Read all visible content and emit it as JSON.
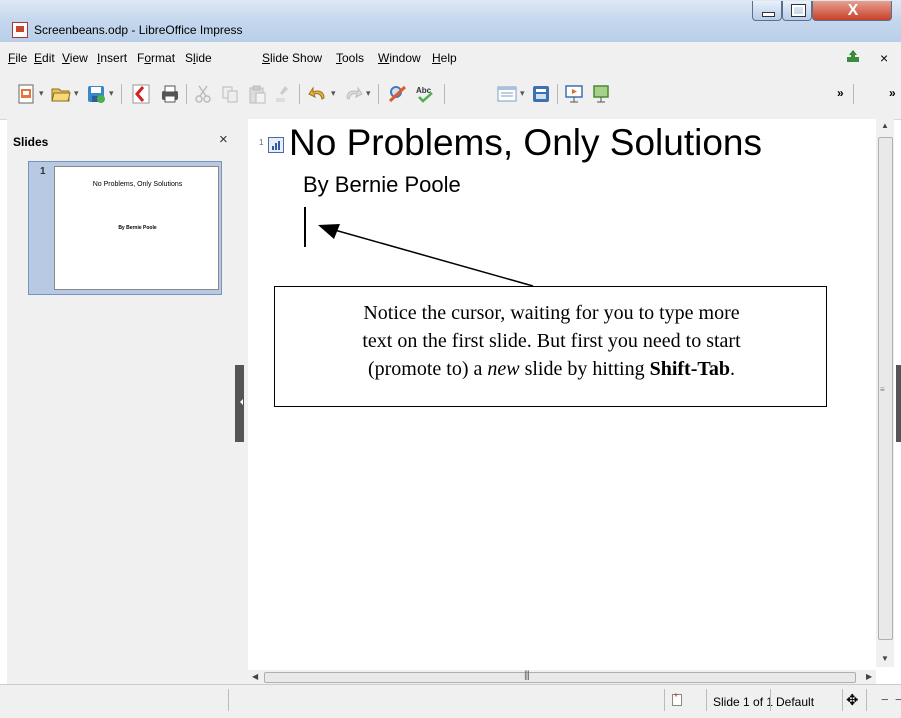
{
  "window": {
    "title": "Screenbeans.odp - LibreOffice Impress",
    "close_glyph": "X"
  },
  "menu": {
    "items": [
      {
        "key": "F",
        "rest": "ile"
      },
      {
        "key": "E",
        "rest": "dit"
      },
      {
        "key": "V",
        "rest": "iew"
      },
      {
        "key": "I",
        "rest": "nsert"
      },
      {
        "pre": "F",
        "key": "o",
        "rest": "rmat"
      },
      {
        "pre": "S",
        "key": "l",
        "rest": "ide"
      },
      {
        "key": "S",
        "rest": "lide Show"
      },
      {
        "key": "T",
        "rest": "ools"
      },
      {
        "key": "W",
        "rest": "indow"
      },
      {
        "key": "H",
        "rest": "elp"
      }
    ],
    "close_glyph": "×"
  },
  "toolbar": {
    "overflow_left": "»",
    "overflow_right": "»"
  },
  "slides_pane": {
    "title": "Slides",
    "close_glyph": "×",
    "thumbnails": [
      {
        "number": "1",
        "title": "No Problems, Only Solutions",
        "subtitle": "By Bernie Poole"
      }
    ]
  },
  "outline": {
    "slide_number": "1",
    "title": "No Problems, Only Solutions",
    "subtitle": "By Bernie Poole"
  },
  "callout": {
    "line1": "Notice the cursor, waiting for you to type more",
    "line2": "text on the first slide. But first you need to start",
    "line3_pre": "(promote to) a ",
    "line3_em": "new",
    "line3_mid": " slide by hitting ",
    "line3_bold": "Shift-Tab",
    "line3_end": "."
  },
  "statusbar": {
    "slide_indicator": "Slide 1 of 1",
    "layout": "Default"
  },
  "colors": {
    "titlebar": "#c6d8ee",
    "close_button": "#c7402a",
    "selection": "#b7c9e3"
  },
  "icons": [
    "impress-app-icon",
    "new-icon",
    "open-icon",
    "save-icon",
    "export-pdf-icon",
    "print-icon",
    "cut-icon",
    "copy-icon",
    "paste-icon",
    "clone-format-icon",
    "undo-icon",
    "redo-icon",
    "spellcheck-icon",
    "autospellcheck-icon",
    "display-views-icon",
    "slide-layout-icon",
    "slideshow-icon",
    "slideshow-current-icon"
  ]
}
